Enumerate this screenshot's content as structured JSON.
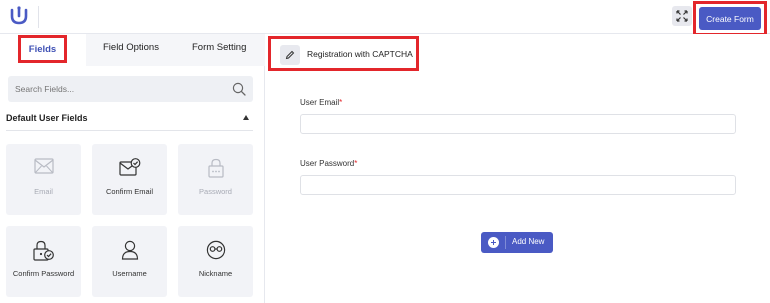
{
  "topbar": {
    "logo": "user-registration-logo",
    "expand_icon": "expand-arrows-icon",
    "create_button_label": "Create Form"
  },
  "left_panel": {
    "tabs": [
      {
        "label": "Fields",
        "active": true
      },
      {
        "label": "Field Options",
        "active": false
      },
      {
        "label": "Form Setting",
        "active": false
      }
    ],
    "search": {
      "placeholder": "Search Fields...",
      "value": ""
    },
    "section": {
      "title": "Default User Fields",
      "expanded": true
    },
    "cards": [
      {
        "label": "Email",
        "icon": "envelope-icon",
        "disabled": true
      },
      {
        "label": "Confirm Email",
        "icon": "envelope-check-icon",
        "disabled": false
      },
      {
        "label": "Password",
        "icon": "lock-dots-icon",
        "disabled": true
      },
      {
        "label": "Confirm Password",
        "icon": "lock-check-icon",
        "disabled": false
      },
      {
        "label": "Username",
        "icon": "user-icon",
        "disabled": false
      },
      {
        "label": "Nickname",
        "icon": "mask-face-icon",
        "disabled": false
      }
    ]
  },
  "main": {
    "form_title": "Registration with CAPTCHA",
    "fields": [
      {
        "label": "User Email",
        "required_mark": "*",
        "value": ""
      },
      {
        "label": "User Password",
        "required_mark": "*",
        "value": ""
      }
    ],
    "add_new_label": "Add New"
  },
  "colors": {
    "accent": "#4a5ac4",
    "active_tab_text": "#3f51b5",
    "highlight_box": "#e3262b",
    "required": "#e3262b"
  }
}
